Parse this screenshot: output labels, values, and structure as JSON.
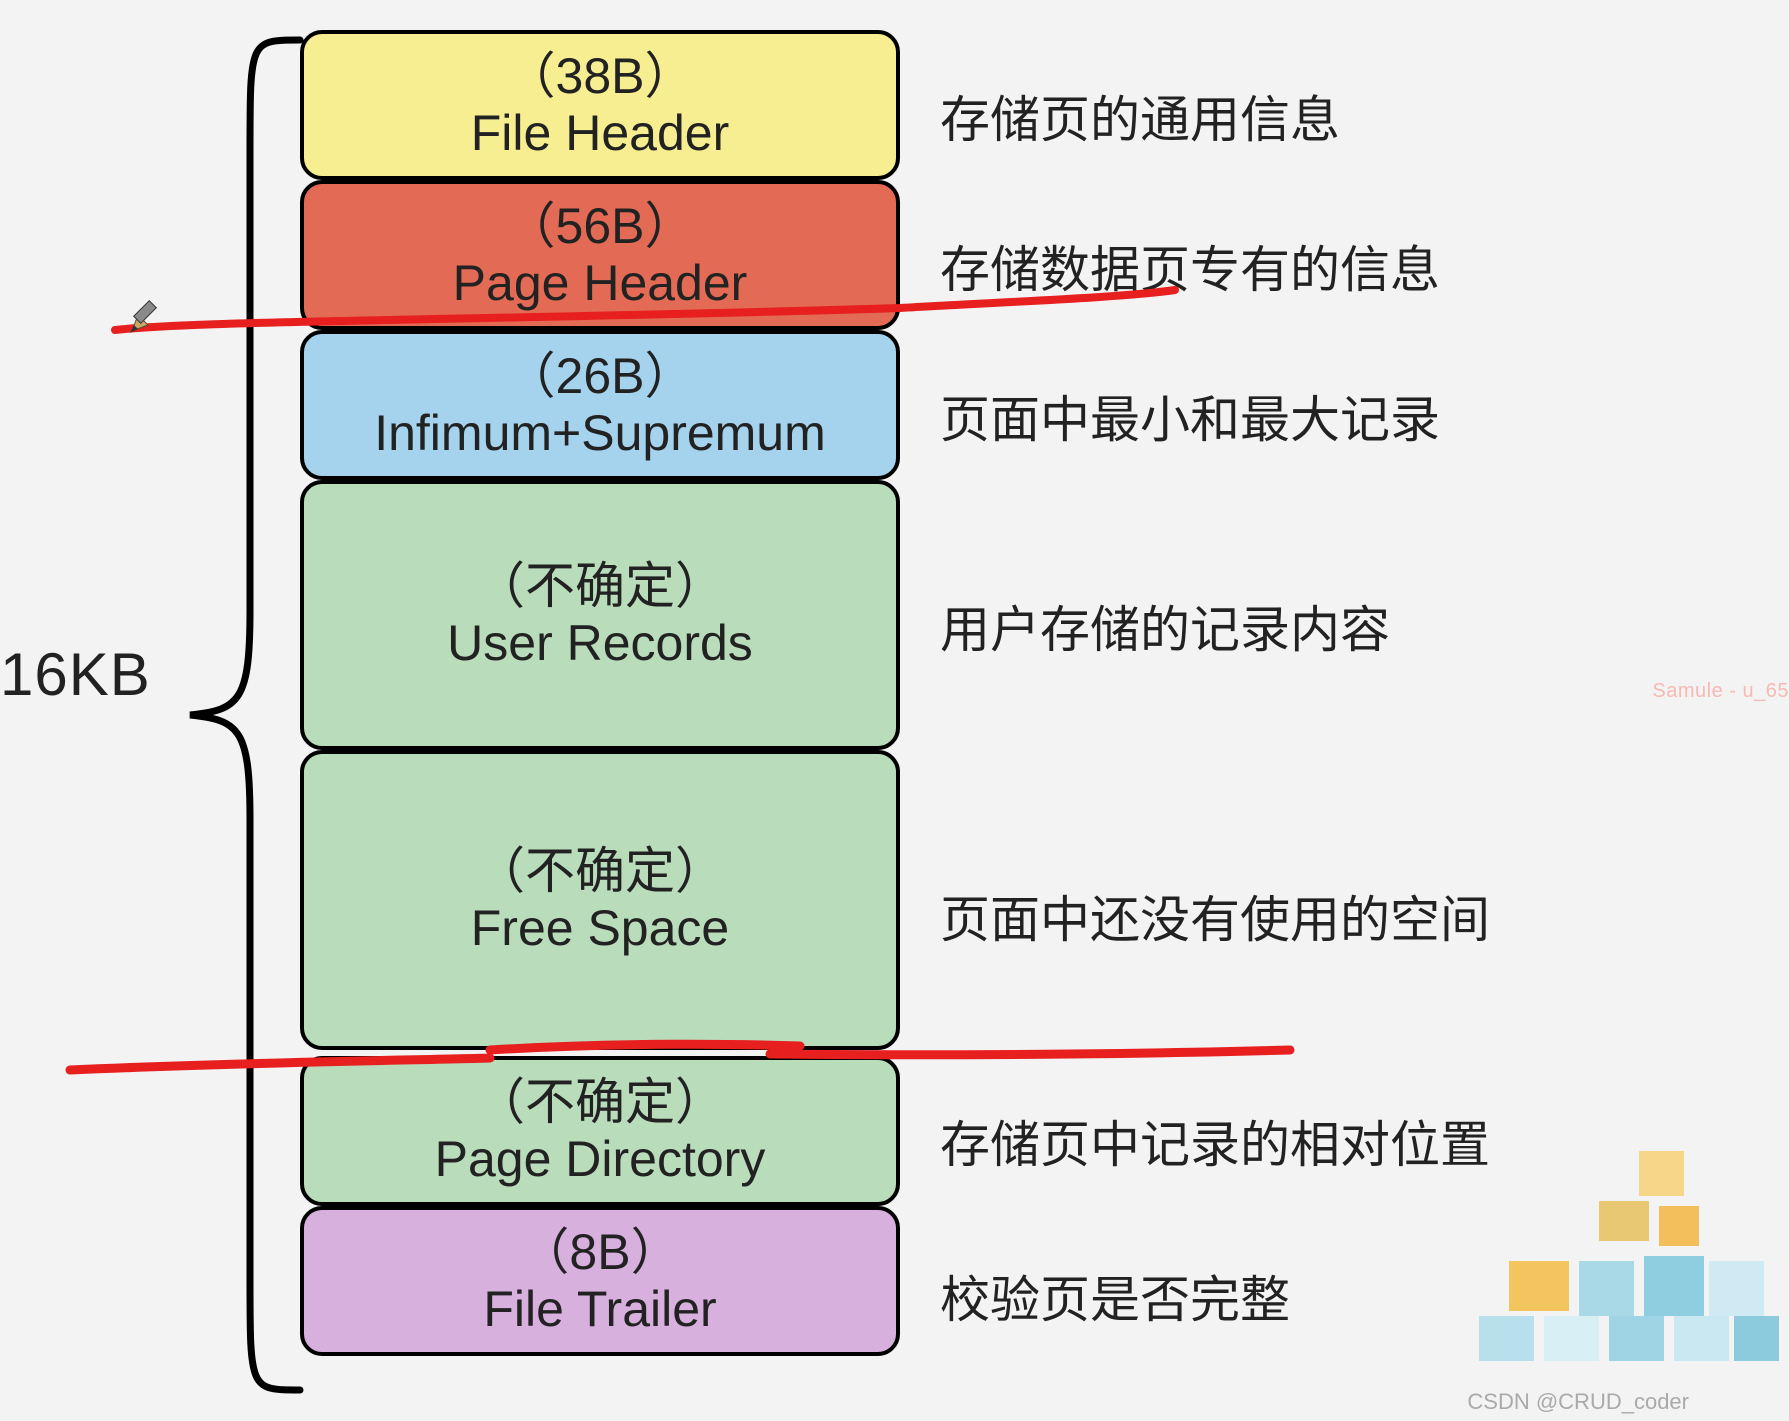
{
  "total_size_label": "16KB",
  "blocks": [
    {
      "size": "（38B）",
      "name": "File Header",
      "desc": "存储页的通用信息"
    },
    {
      "size": "（56B）",
      "name": "Page Header",
      "desc": "存储数据页专有的信息"
    },
    {
      "size": "（26B）",
      "name": "Infimum+Supremum",
      "desc": "页面中最小和最大记录"
    },
    {
      "size": "（不确定）",
      "name": "User Records",
      "desc": "用户存储的记录内容"
    },
    {
      "size": "（不确定）",
      "name": "Free Space",
      "desc": "页面中还没有使用的空间"
    },
    {
      "size": "（不确定）",
      "name": "Page Directory",
      "desc": "存储页中记录的相对位置"
    },
    {
      "size": "（8B）",
      "name": "File Trailer",
      "desc": "校验页是否完整"
    }
  ],
  "watermark_right": "Samule - u_65",
  "watermark_bottom": "CSDN @CRUD_coder"
}
